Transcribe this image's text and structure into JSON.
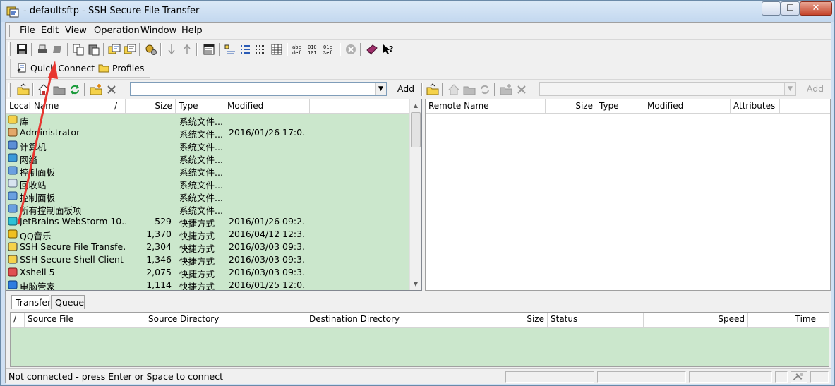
{
  "window": {
    "title": " - defaultsftp - SSH Secure File Transfer",
    "min_glyph": "—",
    "max_glyph": "☐",
    "close_glyph": "✕"
  },
  "menu": {
    "items": [
      "File",
      "Edit",
      "View",
      "Operation",
      "Window",
      "Help"
    ],
    "accelerators": [
      "F",
      "E",
      "V",
      "O",
      "W",
      "H"
    ]
  },
  "quick_bar": {
    "quick_connect_label": "Quick Connect",
    "profiles_label": "Profiles"
  },
  "path_bar": {
    "local_path": "",
    "remote_path": "",
    "local_add_label": "Add",
    "remote_add_label": "Add"
  },
  "local_pane": {
    "columns": [
      "Local Name",
      "/",
      "Size",
      "Type",
      "Modified"
    ],
    "rows": [
      {
        "icon": "library-icon",
        "name": "库",
        "size": "",
        "type": "系统文件...",
        "modified": ""
      },
      {
        "icon": "user-icon",
        "name": "Administrator",
        "size": "",
        "type": "系统文件...",
        "modified": "2016/01/26 17:0..."
      },
      {
        "icon": "computer-icon",
        "name": "计算机",
        "size": "",
        "type": "系统文件...",
        "modified": ""
      },
      {
        "icon": "network-icon",
        "name": "网络",
        "size": "",
        "type": "系统文件...",
        "modified": ""
      },
      {
        "icon": "control-panel-icon",
        "name": "控制面板",
        "size": "",
        "type": "系统文件...",
        "modified": ""
      },
      {
        "icon": "recycle-bin-icon",
        "name": "回收站",
        "size": "",
        "type": "系统文件...",
        "modified": ""
      },
      {
        "icon": "control-panel-icon",
        "name": "控制面板",
        "size": "",
        "type": "系统文件...",
        "modified": ""
      },
      {
        "icon": "control-panel-icon",
        "name": "所有控制面板项",
        "size": "",
        "type": "系统文件...",
        "modified": ""
      },
      {
        "icon": "webstorm-icon",
        "name": "JetBrains WebStorm 10....",
        "size": "529",
        "type": "快捷方式",
        "modified": "2016/01/26 09:2..."
      },
      {
        "icon": "qq-music-icon",
        "name": "QQ音乐",
        "size": "1,370",
        "type": "快捷方式",
        "modified": "2016/04/12 12:3..."
      },
      {
        "icon": "ssh-transfer-icon",
        "name": "SSH Secure File Transfe...",
        "size": "2,304",
        "type": "快捷方式",
        "modified": "2016/03/03 09:3..."
      },
      {
        "icon": "ssh-shell-icon",
        "name": "SSH Secure Shell Client",
        "size": "1,346",
        "type": "快捷方式",
        "modified": "2016/03/03 09:3..."
      },
      {
        "icon": "xshell-icon",
        "name": "Xshell 5",
        "size": "2,075",
        "type": "快捷方式",
        "modified": "2016/03/03 09:3..."
      },
      {
        "icon": "pc-manager-icon",
        "name": "电脑管家",
        "size": "1,114",
        "type": "快捷方式",
        "modified": "2016/01/25 12:0..."
      }
    ]
  },
  "remote_pane": {
    "columns": [
      "Remote Name",
      "Size",
      "Type",
      "Modified",
      "Attributes"
    ]
  },
  "transfer_tabs": [
    "Transfer",
    "Queue"
  ],
  "transfer_pane": {
    "columns": [
      "/",
      "Source File",
      "Source Directory",
      "Destination Directory",
      "Size",
      "Status",
      "Speed",
      "Time"
    ]
  },
  "status_bar": {
    "text": "Not connected - press Enter or Space to connect"
  },
  "colors": {
    "list_bg": "#cbe7cc",
    "annotation_arrow": "#e8352f"
  }
}
